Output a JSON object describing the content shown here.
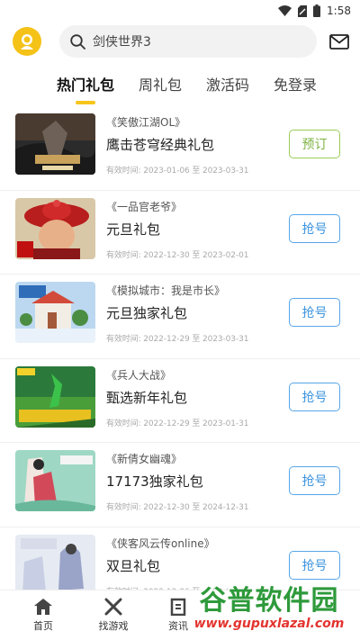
{
  "status": {
    "time": "1:58"
  },
  "search": {
    "text": "剑侠世界3"
  },
  "tabs": [
    {
      "label": "热门礼包",
      "active": true
    },
    {
      "label": "周礼包"
    },
    {
      "label": "激活码"
    },
    {
      "label": "免登录"
    }
  ],
  "items": [
    {
      "game": "《笑傲江湖OL》",
      "title": "鹰击苍穹经典礼包",
      "date": "有效时间: 2023-01-06 至 2023-03-31",
      "button": "预订",
      "thumb_theme": "dark"
    },
    {
      "game": "《一品官老爷》",
      "title": "元旦礼包",
      "date": "有效时间: 2022-12-30 至 2023-02-01",
      "button": "抢号",
      "thumb_theme": "red"
    },
    {
      "game": "《模拟城市：我是市长》",
      "title": "元旦独家礼包",
      "date": "有效时间: 2022-12-29 至 2023-03-31",
      "button": "抢号",
      "thumb_theme": "city"
    },
    {
      "game": "《兵人大战》",
      "title": "甄选新年礼包",
      "date": "有效时间: 2022-12-29 至 2023-01-31",
      "button": "抢号",
      "thumb_theme": "green"
    },
    {
      "game": "《新倩女幽魂》",
      "title": "17173独家礼包",
      "date": "有效时间: 2022-12-30 至 2024-12-31",
      "button": "抢号",
      "thumb_theme": "mint"
    },
    {
      "game": "《侠客风云传online》",
      "title": "双旦礼包",
      "date": "有效时间: 2022-12-26 至 2023-01-31",
      "button": "抢号",
      "thumb_theme": "pale"
    }
  ],
  "bottom_nav": [
    {
      "label": "首页",
      "icon": "home-icon"
    },
    {
      "label": "找游戏",
      "icon": "game-icon"
    },
    {
      "label": "资讯",
      "icon": "news-icon"
    }
  ],
  "watermark": {
    "text": "谷普软件园",
    "url": "www.gupuxlazal.com"
  }
}
